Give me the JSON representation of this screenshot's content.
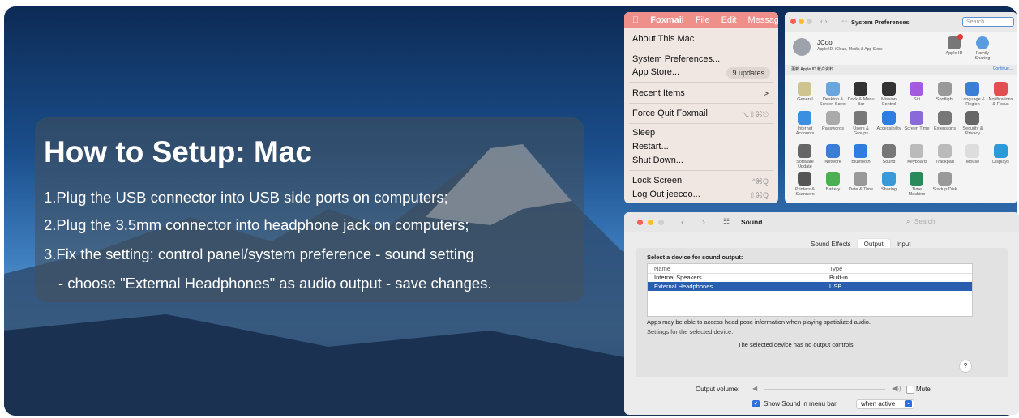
{
  "heading": {
    "title": "How to Setup: Mac",
    "steps": [
      "1.Plug the USB connector into USB side ports on computers;",
      "2.Plug the 3.5mm connector into headphone jack on computers;",
      "3.Fix the setting: control panel/system preference - sound setting",
      "- choose \"External Headphones\" as audio output - save changes."
    ]
  },
  "apple_menu": {
    "menubar": [
      "Foxmail",
      "File",
      "Edit",
      "Messag"
    ],
    "items": {
      "about": "About This Mac",
      "sysprefs": "System Preferences...",
      "appstore": "App Store...",
      "appstore_badge": "9 updates",
      "recent": "Recent Items",
      "recent_arrow": ">",
      "forcequit": "Force Quit Foxmail",
      "forcequit_key": "⌥⇧⌘⎋",
      "sleep": "Sleep",
      "restart": "Restart...",
      "shutdown": "Shut Down...",
      "lock": "Lock Screen",
      "lock_key": "^⌘Q",
      "logout": "Log Out jeecoo...",
      "logout_key": "⇧⌘Q"
    }
  },
  "sys_prefs": {
    "title": "System Preferences",
    "search": "Search",
    "user_name": "JCool",
    "user_sub": "Apple ID, iCloud, Media & App Store",
    "apple_id": "Apple ID",
    "family": "Family Sharing",
    "section": "更新 Apple ID 帐户资料",
    "continue": "Continue...",
    "icons": [
      "General",
      "Desktop & Screen Saver",
      "Dock & Menu Bar",
      "Mission Control",
      "Siri",
      "Spotlight",
      "Language & Region",
      "Notifications & Focus",
      "Internet Accounts",
      "Passwords",
      "Users & Groups",
      "Accessibility",
      "Screen Time",
      "Extensions",
      "Security & Privacy",
      "Software Update",
      "Network",
      "Bluetooth",
      "Sound",
      "Keyboard",
      "Trackpad",
      "Mouse",
      "Displays",
      "Printers & Scanners",
      "Battery",
      "Date & Time",
      "Sharing",
      "Time Machine",
      "Startup Disk"
    ],
    "icon_colors": [
      "#cfc390",
      "#6aa6de",
      "#333",
      "#333",
      "#a55be0",
      "#999",
      "#3a7fd5",
      "#e05050",
      "#3a8fe0",
      "#aaa",
      "#777",
      "#2f7de0",
      "#8a6ad8",
      "#777",
      "#666",
      "#666",
      "#3a7fd5",
      "#2f7de0",
      "#777",
      "#bbb",
      "#bbb",
      "#ddd",
      "#2a9ad8",
      "#555",
      "#4cb050",
      "#999",
      "#3a9ad8",
      "#2a8a5a",
      "#999"
    ]
  },
  "sound": {
    "title": "Sound",
    "search": "Search",
    "tabs": [
      "Sound Effects",
      "Output",
      "Input"
    ],
    "select_label": "Select a device for sound output:",
    "col_name": "Name",
    "col_type": "Type",
    "rows": [
      {
        "name": "Internal Speakers",
        "type": "Built-in"
      },
      {
        "name": "External Headphones",
        "type": "USB"
      }
    ],
    "note": "Apps may be able to access head pose information when playing spatialized audio.",
    "settings_label": "Settings for the selected device:",
    "no_controls": "The selected device has no output controls",
    "help": "?",
    "volume_label": "Output volume:",
    "mute": "Mute",
    "show_sound": "Show Sound in menu bar",
    "when_active": "when active"
  }
}
